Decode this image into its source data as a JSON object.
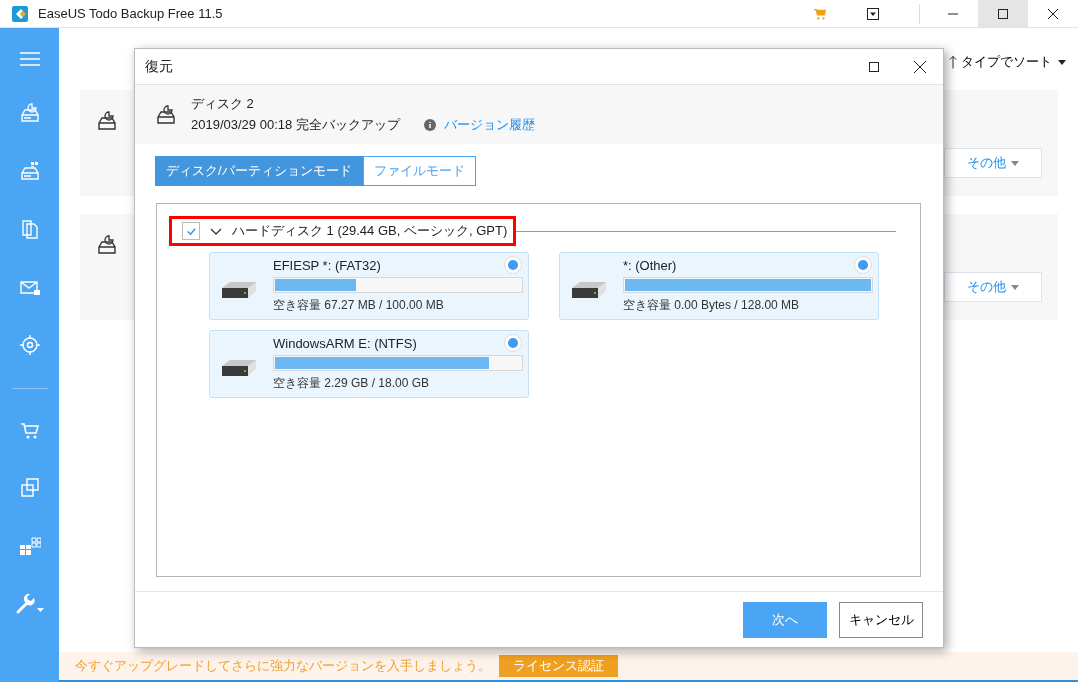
{
  "window": {
    "title": "EaseUS Todo Backup Free 11.5"
  },
  "sort": {
    "label": "タイプでソート"
  },
  "backup_cards": [
    {
      "button": "その他"
    },
    {
      "button": "その他"
    }
  ],
  "dialog": {
    "title": "復元",
    "source": {
      "name": "ディスク 2",
      "detail": "2019/03/29 00:18 完全バックアップ",
      "link": "バージョン履歴"
    },
    "tabs": [
      {
        "label": "ディスク/パーティションモード",
        "selected": true
      },
      {
        "label": "ファイルモード",
        "selected": false
      }
    ],
    "disk": {
      "label": "ハードディスク 1 (29.44 GB, ベーシック, GPT)",
      "checked": true,
      "expanded": true
    },
    "partitions": [
      {
        "name": "EFIESP *: (FAT32)",
        "free": "空き容量 67.27 MB / 100.00 MB",
        "level": 0.33,
        "selected": true
      },
      {
        "name": "*: (Other)",
        "free": "空き容量 0.00 Bytes / 128.00 MB",
        "level": 1,
        "selected": true
      },
      {
        "name": "WindowsARM E: (NTFS)",
        "free": "空き容量 2.29 GB / 18.00 GB",
        "level": 0.87,
        "selected": true
      }
    ],
    "buttons": [
      {
        "label": "次へ",
        "kind": "primary"
      },
      {
        "label": "キャンセル",
        "kind": "secondary"
      }
    ]
  },
  "banner": {
    "text": "今すぐアップグレードしてさらに強力なバージョンを入手しましょう。",
    "button": "ライセンス認証"
  }
}
